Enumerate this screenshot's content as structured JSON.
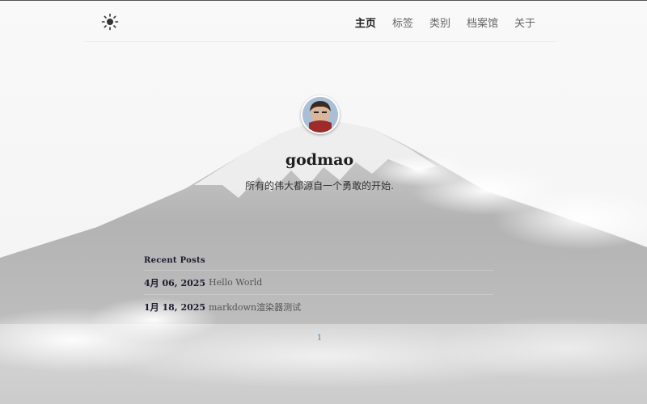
{
  "header": {
    "theme_icon": "sun-icon",
    "nav": [
      {
        "label": "主页"
      },
      {
        "label": "标签"
      },
      {
        "label": "类别"
      },
      {
        "label": "档案馆"
      },
      {
        "label": "关于"
      }
    ]
  },
  "profile": {
    "name": "godmao",
    "motto": "所有的伟大都源自一个勇敢的开始."
  },
  "recent": {
    "title": "Recent Posts",
    "posts": [
      {
        "date": "4月 06, 2025",
        "title": "Hello World"
      },
      {
        "date": "1月 18, 2025",
        "title": "markdown渲染器测试"
      }
    ]
  },
  "pagination": {
    "current": "1"
  },
  "colors": {
    "background": "#f8f8f8",
    "nav_active": "#222222",
    "nav_inactive": "#666666",
    "link_accent": "#3a8bd4"
  }
}
